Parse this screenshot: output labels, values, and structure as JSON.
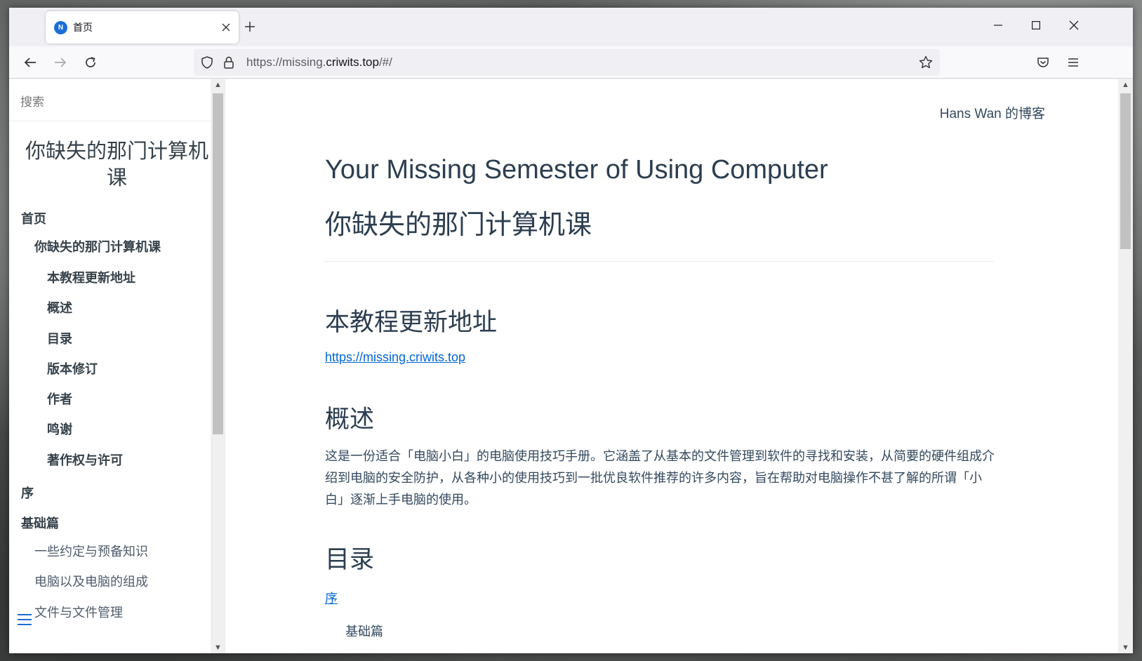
{
  "browser": {
    "tab_title": "首页",
    "url_prefix": "https://missing.",
    "url_domain": "criwits.top",
    "url_suffix": "/#/"
  },
  "sidebar": {
    "search_placeholder": "搜索",
    "title": "你缺失的那门计算机课",
    "items": [
      {
        "label": "首页",
        "level": 1,
        "bold": true
      },
      {
        "label": "你缺失的那门计算机课",
        "level": 2,
        "bold": true
      },
      {
        "label": "本教程更新地址",
        "level": 3,
        "bold": true
      },
      {
        "label": "概述",
        "level": 3,
        "bold": true
      },
      {
        "label": "目录",
        "level": 3,
        "bold": true
      },
      {
        "label": "版本修订",
        "level": 3,
        "bold": true
      },
      {
        "label": "作者",
        "level": 3,
        "bold": true
      },
      {
        "label": "鸣谢",
        "level": 3,
        "bold": true
      },
      {
        "label": "著作权与许可",
        "level": 3,
        "bold": true
      },
      {
        "label": "序",
        "level": 1,
        "bold": true
      },
      {
        "label": "基础篇",
        "level": 1,
        "bold": true
      },
      {
        "label": "一些约定与预备知识",
        "level": 2,
        "bold": false
      },
      {
        "label": "电脑以及电脑的组成",
        "level": 2,
        "bold": false
      },
      {
        "label": "文件与文件管理",
        "level": 2,
        "bold": false
      }
    ]
  },
  "main": {
    "blog_link": "Hans Wan 的博客",
    "title_en": "Your Missing Semester of Using Computer",
    "title_cn": "你缺失的那门计算机课",
    "section_update": "本教程更新地址",
    "update_link": "https://missing.criwits.top",
    "section_overview": "概述",
    "overview_text": "这是一份适合「电脑小白」的电脑使用技巧手册。它涵盖了从基本的文件管理到软件的寻找和安装，从简要的硬件组成介绍到电脑的安全防护，从各种小的使用技巧到一批优良软件推荐的许多内容，旨在帮助对电脑操作不甚了解的所谓「小白」逐渐上手电脑的使用。",
    "section_toc": "目录",
    "toc_first": "序",
    "toc_partial": "基础篇"
  }
}
